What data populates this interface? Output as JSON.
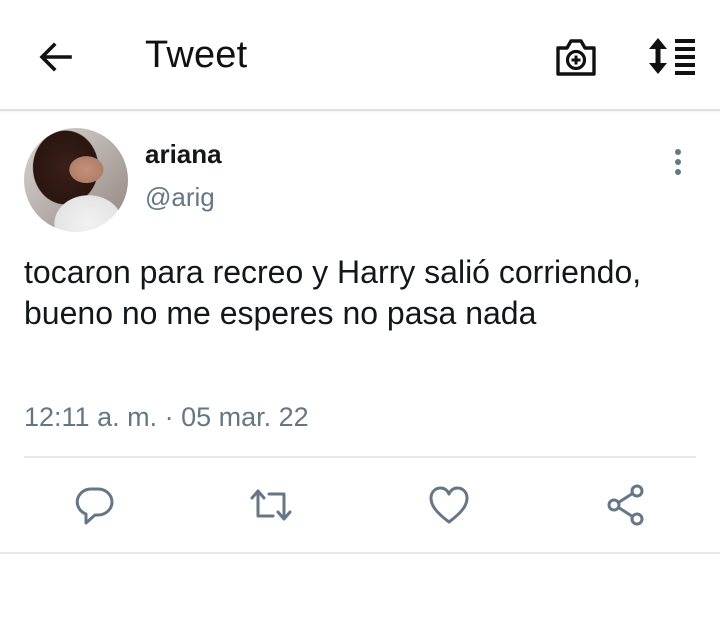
{
  "header": {
    "title": "Tweet",
    "back_icon": "arrow-left-icon",
    "camera_icon": "camera-plus-icon",
    "sort_icon": "sort-list-icon"
  },
  "tweet": {
    "author_name": "ariana",
    "author_handle": "@arig",
    "text": "tocaron para recreo y Harry salió corriendo, bueno no me esperes no pasa nada",
    "timestamp": "12:11 a. m. · 05 mar. 22",
    "more_icon": "more-vertical-icon"
  },
  "actions": [
    {
      "icon": "reply-icon"
    },
    {
      "icon": "retweet-icon"
    },
    {
      "icon": "like-icon"
    },
    {
      "icon": "share-icon"
    }
  ],
  "colors": {
    "primary_text": "#14171a",
    "secondary_text": "#657786",
    "icon": "#657786",
    "divider": "#e6e8ea"
  }
}
